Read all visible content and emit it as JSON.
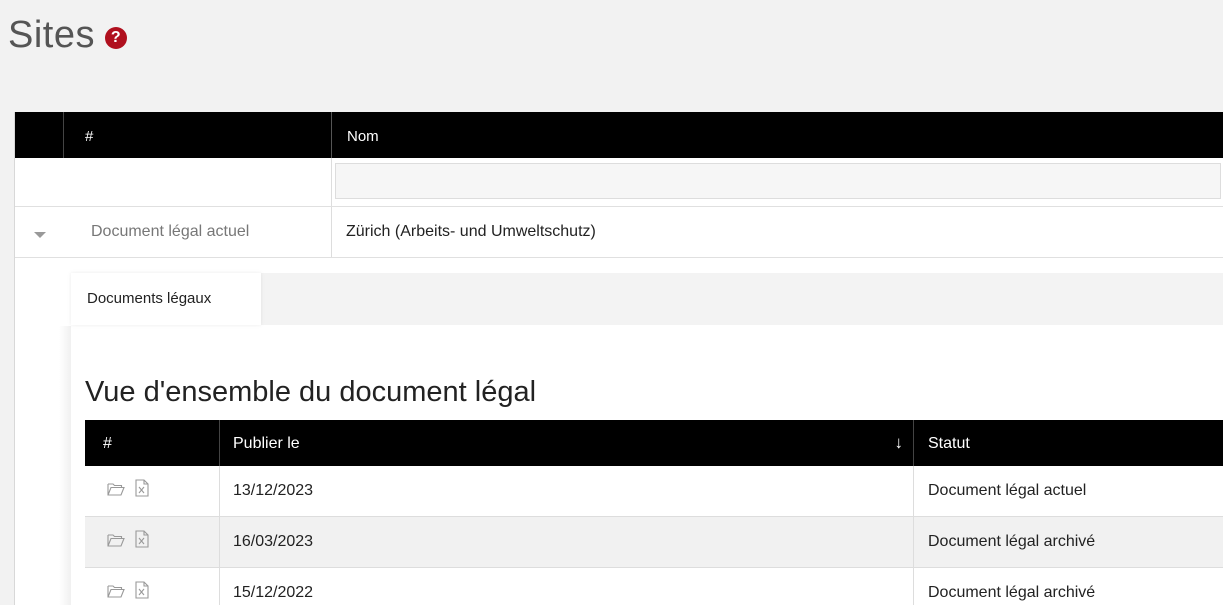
{
  "page": {
    "title": "Sites",
    "help_icon": "question-circle-icon",
    "help_symbol": "?",
    "accent": "#b0101e"
  },
  "sites_table": {
    "columns": [
      "#",
      "Nom"
    ],
    "filter_value": "",
    "row": {
      "num": "Document légal actuel",
      "nom": "Zürich (Arbeits- und Umweltschutz)"
    }
  },
  "tabs": [
    {
      "label": "Documents légaux",
      "active": true
    }
  ],
  "section_title": "Vue d'ensemble du document légal",
  "doc_table": {
    "columns": [
      "#",
      "Publier le",
      "Statut"
    ],
    "sort_icon": "arrow-down-icon",
    "sort_symbol": "↓",
    "rows": [
      {
        "date": "13/12/2023",
        "status": "Document légal actuel"
      },
      {
        "date": "16/03/2023",
        "status": "Document légal archivé"
      },
      {
        "date": "15/12/2022",
        "status": "Document légal archivé"
      }
    ]
  }
}
